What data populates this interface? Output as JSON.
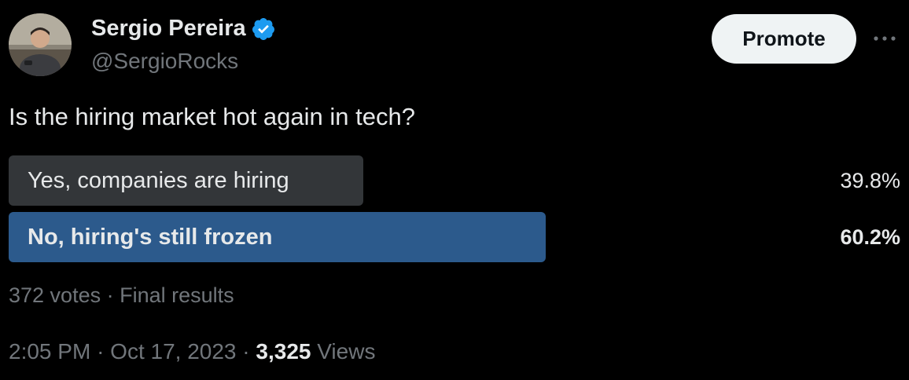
{
  "user": {
    "display_name": "Sergio Pereira",
    "handle": "@SergioRocks",
    "verified_icon": "verified-badge-icon"
  },
  "header": {
    "promote_label": "Promote",
    "more_icon": "more-horizontal-icon"
  },
  "tweet": {
    "text": "Is the hiring market hot again in tech?"
  },
  "poll": {
    "options": [
      {
        "label": "Yes, companies are hiring",
        "percent_text": "39.8%",
        "percent": 39.8,
        "winner": false,
        "bar_color": "#333639"
      },
      {
        "label": "No, hiring's still frozen",
        "percent_text": "60.2%",
        "percent": 60.2,
        "winner": true,
        "bar_color": "#2c5a8c"
      }
    ],
    "votes": "372 votes",
    "separator": "·",
    "status": "Final results"
  },
  "footer": {
    "time": "2:05 PM",
    "date": "Oct 17, 2023",
    "separator": "·",
    "views_count": "3,325",
    "views_label": "Views"
  },
  "colors": {
    "background": "#000000",
    "text_primary": "#e7e9ea",
    "text_secondary": "#71767b",
    "verified_blue": "#1d9bf0",
    "button_bg": "#eff3f4"
  }
}
